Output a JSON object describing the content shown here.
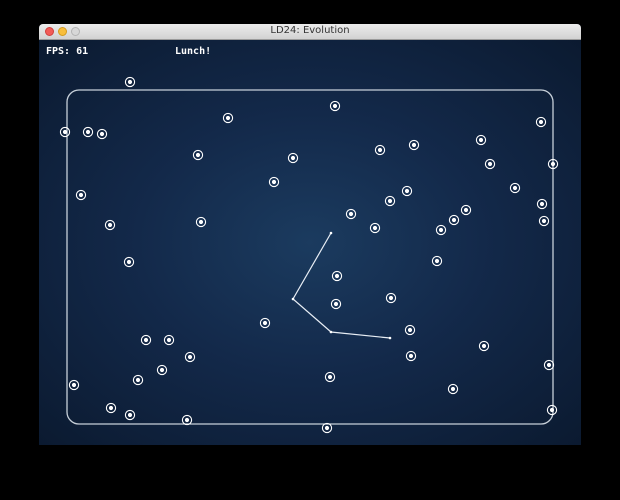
{
  "window": {
    "title": "LD24: Evolution"
  },
  "hud": {
    "fps_label": "FPS:",
    "fps_value": "61",
    "message": "Lunch!"
  },
  "colors": {
    "background": "#0b1a30",
    "arena_border": "#c7d0d9",
    "food": "#ffffff",
    "creature": "#e8eef5"
  },
  "food_count": 60
}
